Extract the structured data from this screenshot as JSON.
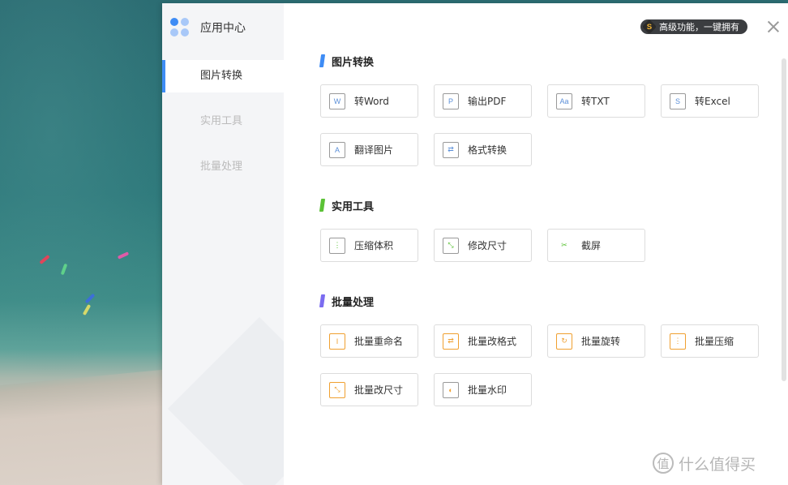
{
  "app": {
    "title": "应用中心"
  },
  "promo": {
    "badge_letter": "S",
    "text": "高级功能，一键拥有"
  },
  "nav": [
    {
      "label": "图片转换",
      "active": true
    },
    {
      "label": "实用工具",
      "active": false
    },
    {
      "label": "批量处理",
      "active": false
    }
  ],
  "sections": {
    "image_convert": {
      "title": "图片转换",
      "accent": "#3e8cf5",
      "tools": [
        {
          "label": "转Word",
          "icon": "word-icon",
          "glyph": "W"
        },
        {
          "label": "输出PDF",
          "icon": "pdf-icon",
          "glyph": "P"
        },
        {
          "label": "转TXT",
          "icon": "txt-icon",
          "glyph": "Aa"
        },
        {
          "label": "转Excel",
          "icon": "excel-icon",
          "glyph": "S"
        },
        {
          "label": "翻译图片",
          "icon": "translate-icon",
          "glyph": "A"
        },
        {
          "label": "格式转换",
          "icon": "format-convert-icon",
          "glyph": "⇄"
        }
      ]
    },
    "utilities": {
      "title": "实用工具",
      "accent": "#5bc236",
      "tools": [
        {
          "label": "压缩体积",
          "icon": "compress-icon",
          "glyph": "⋮"
        },
        {
          "label": "修改尺寸",
          "icon": "resize-icon",
          "glyph": "⤡"
        },
        {
          "label": "截屏",
          "icon": "screenshot-icon",
          "glyph": "✂"
        }
      ]
    },
    "batch": {
      "title": "批量处理",
      "accent": "#7b6cf0",
      "tools": [
        {
          "label": "批量重命名",
          "icon": "batch-rename-icon",
          "glyph": "I"
        },
        {
          "label": "批量改格式",
          "icon": "batch-format-icon",
          "glyph": "⇄"
        },
        {
          "label": "批量旋转",
          "icon": "batch-rotate-icon",
          "glyph": "↻"
        },
        {
          "label": "批量压缩",
          "icon": "batch-compress-icon",
          "glyph": "⋮"
        },
        {
          "label": "批量改尺寸",
          "icon": "batch-resize-icon",
          "glyph": "⤡"
        },
        {
          "label": "批量水印",
          "icon": "batch-watermark-icon",
          "glyph": "◐"
        }
      ]
    }
  },
  "watermark": {
    "text": "什么值得买",
    "glyph": "值"
  },
  "colors": {
    "blue": "#3e8cf5",
    "green": "#5bc236",
    "purple": "#7b6cf0",
    "orange": "#f0a030"
  }
}
